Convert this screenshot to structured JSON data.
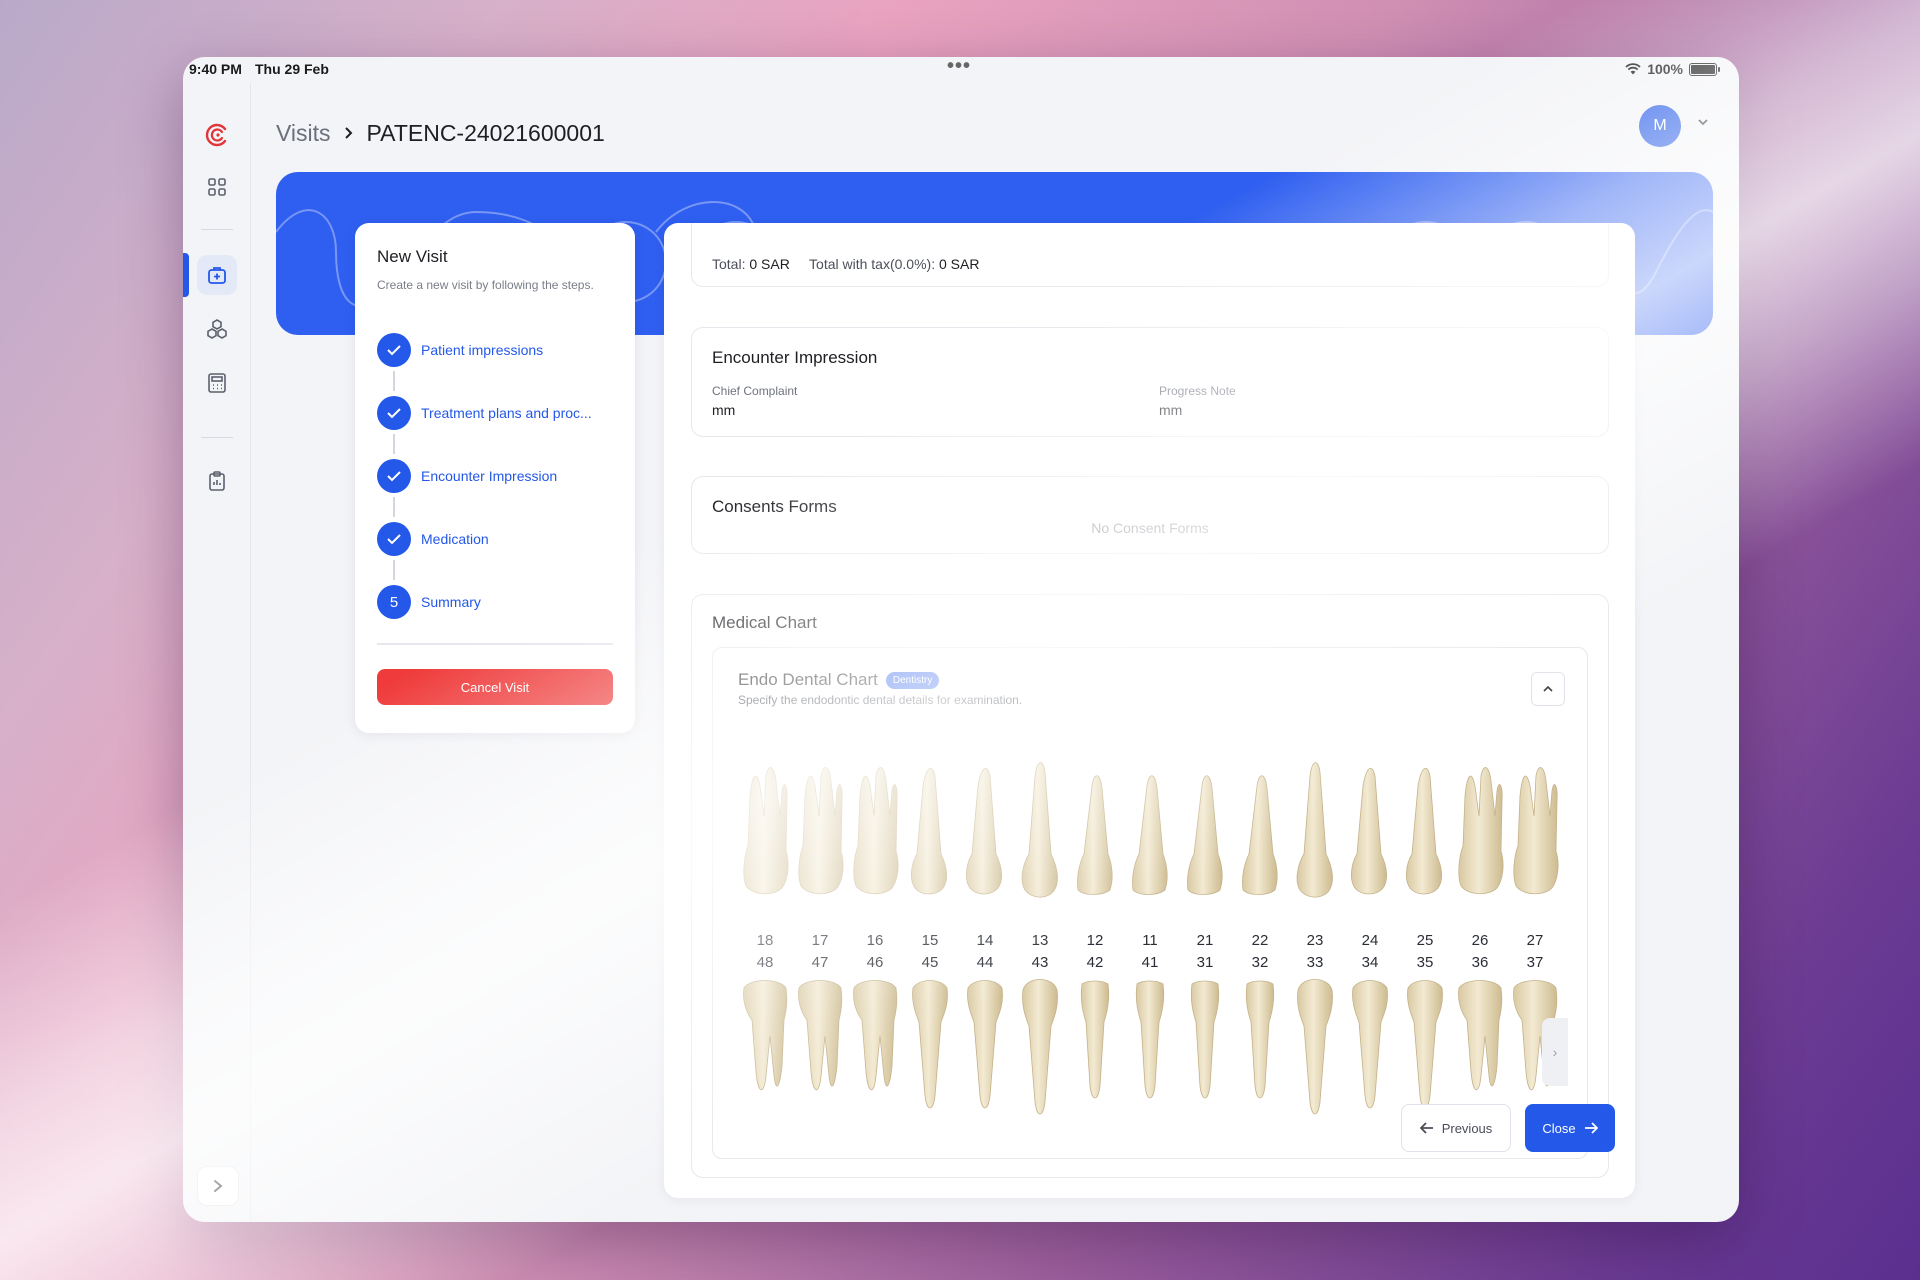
{
  "status_bar": {
    "time": "9:40 PM",
    "date": "Thu 29 Feb",
    "battery": "100%",
    "battery_level": 1.0
  },
  "header": {
    "breadcrumb_root": "Visits",
    "breadcrumb_current": "PATENC-24021600001",
    "avatar_initial": "M"
  },
  "sidebar": {
    "items": [
      {
        "icon": "logo-icon"
      },
      {
        "icon": "grid-icon"
      },
      {
        "icon": "medical-bag-icon",
        "active": true
      },
      {
        "icon": "hexagons-icon"
      },
      {
        "icon": "calculator-icon"
      },
      {
        "icon": "clipboard-icon"
      }
    ]
  },
  "stepper": {
    "title": "New Visit",
    "subtitle": "Create a new visit by following the steps.",
    "steps": [
      {
        "label": "Patient impressions",
        "state": "done"
      },
      {
        "label": "Treatment plans and proc...",
        "state": "done"
      },
      {
        "label": "Encounter Impression",
        "state": "done"
      },
      {
        "label": "Medication",
        "state": "done"
      },
      {
        "label": "Summary",
        "state": "current",
        "number": "5"
      }
    ],
    "cancel_label": "Cancel Visit"
  },
  "summary": {
    "total_label": "Total:",
    "total_value": "0 SAR",
    "total_tax_label": "Total with tax(0.0%):",
    "total_tax_value": "0 SAR",
    "encounter": {
      "title": "Encounter Impression",
      "chief_complaint_label": "Chief Complaint",
      "chief_complaint_value": "mm",
      "progress_note_label": "Progress Note",
      "progress_note_value": "mm"
    },
    "consents": {
      "title": "Consents Forms",
      "empty_text": "No Consent Forms"
    },
    "medical_chart": {
      "title": "Medical Chart",
      "endo": {
        "title": "Endo Dental Chart",
        "badge": "Dentistry",
        "subtitle": "Specify the endodontic dental details for examination.",
        "upper_numbers": [
          "18",
          "17",
          "16",
          "15",
          "14",
          "13",
          "12",
          "11",
          "21",
          "22",
          "23",
          "24",
          "25",
          "26",
          "27"
        ],
        "lower_numbers": [
          "48",
          "47",
          "46",
          "45",
          "44",
          "43",
          "42",
          "41",
          "31",
          "32",
          "33",
          "34",
          "35",
          "36",
          "37"
        ]
      }
    }
  },
  "footer": {
    "previous_label": "Previous",
    "close_label": "Close"
  },
  "colors": {
    "accent": "#2358e8",
    "danger": "#ef3b3b",
    "banner": "#2f5ff0"
  }
}
